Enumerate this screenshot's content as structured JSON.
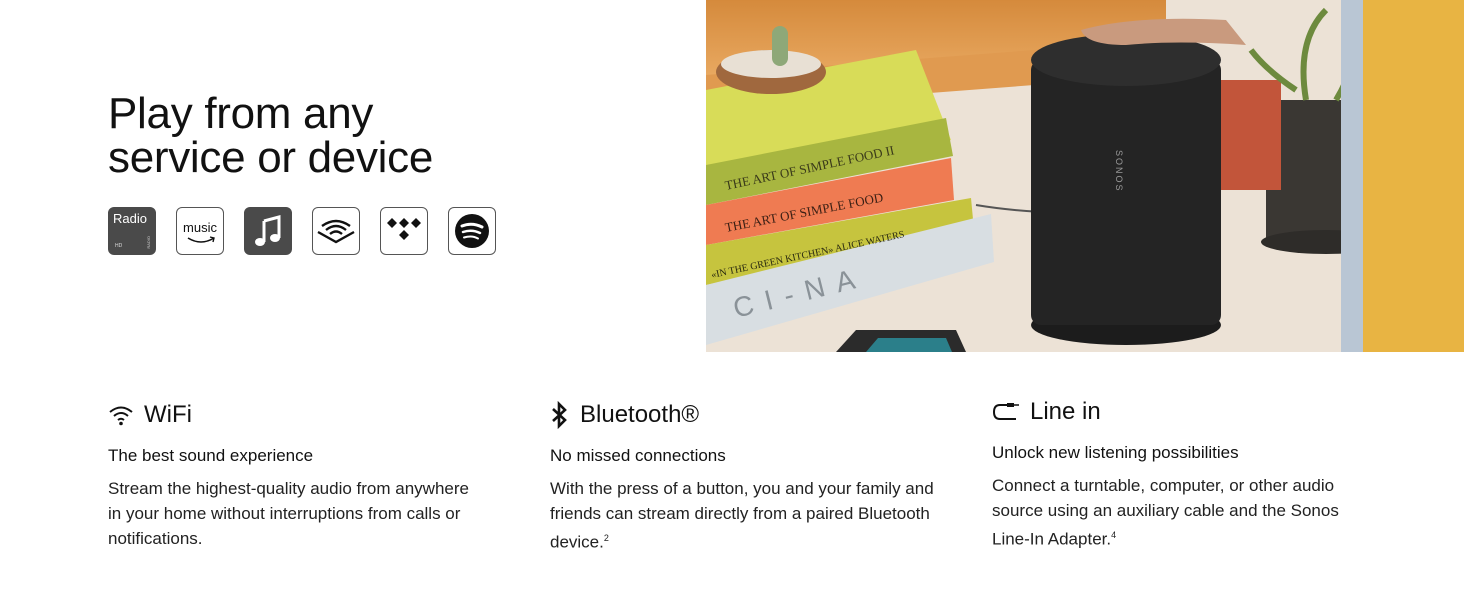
{
  "headline": {
    "line1": "Play from any",
    "line2": "service or device"
  },
  "services": [
    {
      "name": "iHeartRadio / Radio HD",
      "icon": "radio-hd-icon",
      "label": "Radio",
      "sub": "HD"
    },
    {
      "name": "Amazon Music",
      "icon": "amazon-music-icon",
      "label": "music"
    },
    {
      "name": "Apple Music",
      "icon": "apple-music-icon"
    },
    {
      "name": "Audible",
      "icon": "audible-icon"
    },
    {
      "name": "TIDAL",
      "icon": "tidal-icon"
    },
    {
      "name": "Spotify",
      "icon": "spotify-icon"
    }
  ],
  "photo": {
    "alt": "Sonos Move speaker on a table next to books and plants",
    "speaker_brand": "SONOS",
    "books": [
      "THE ART OF SIMPLE FOOD II",
      "THE ART OF SIMPLE FOOD",
      "IN THE GREEN KITCHEN · ALICE WATERS",
      "CHINA"
    ]
  },
  "features": [
    {
      "icon": "wifi-icon",
      "title": "WiFi",
      "subtitle": "The best sound experience",
      "body": "Stream the highest-quality audio from anywhere in your home without interruptions from calls or notifications.",
      "footnote": ""
    },
    {
      "icon": "bluetooth-icon",
      "title": "Bluetooth®",
      "subtitle": "No missed connections",
      "body": "With the press of a button, you and your family and friends can stream directly from a paired Bluetooth device.",
      "footnote": "2"
    },
    {
      "icon": "line-in-icon",
      "title": "Line in",
      "subtitle": "Unlock new listening possibilities",
      "body": "Connect a turntable, computer, or other audio source using an auxiliary cable and the Sonos Line-In Adapter.",
      "footnote": "4"
    }
  ]
}
